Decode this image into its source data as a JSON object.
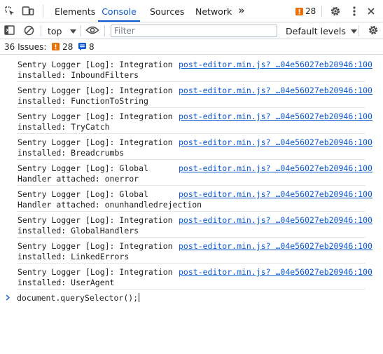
{
  "tabs": {
    "elements": "Elements",
    "console": "Console",
    "sources": "Sources",
    "network": "Network",
    "more": "»"
  },
  "header": {
    "warning_count": "28"
  },
  "toolbar": {
    "context": "top",
    "filter_placeholder": "Filter",
    "levels": "Default levels"
  },
  "issues": {
    "label": "36 Issues:",
    "warnings": "28",
    "messages": "8"
  },
  "messages": [
    {
      "line1": "Sentry Logger [Log]: Integration",
      "line2": "installed: InboundFilters",
      "source": "post-editor.min.js? …04e56027eb20946:100"
    },
    {
      "line1": "Sentry Logger [Log]: Integration",
      "line2": "installed: FunctionToString",
      "source": "post-editor.min.js? …04e56027eb20946:100"
    },
    {
      "line1": "Sentry Logger [Log]: Integration",
      "line2": "installed: TryCatch",
      "source": "post-editor.min.js? …04e56027eb20946:100"
    },
    {
      "line1": "Sentry Logger [Log]: Integration",
      "line2": "installed: Breadcrumbs",
      "source": "post-editor.min.js? …04e56027eb20946:100"
    },
    {
      "line1": "Sentry Logger [Log]: Global",
      "line2": "Handler attached: onerror",
      "source": "post-editor.min.js? …04e56027eb20946:100"
    },
    {
      "line1": "Sentry Logger [Log]: Global",
      "line2": "Handler attached: onunhandledrejection",
      "source": "post-editor.min.js? …04e56027eb20946:100"
    },
    {
      "line1": "Sentry Logger [Log]: Integration",
      "line2": "installed: GlobalHandlers",
      "source": "post-editor.min.js? …04e56027eb20946:100"
    },
    {
      "line1": "Sentry Logger [Log]: Integration",
      "line2": "installed: LinkedErrors",
      "source": "post-editor.min.js? …04e56027eb20946:100"
    },
    {
      "line1": "Sentry Logger [Log]: Integration",
      "line2": "installed: UserAgent",
      "source": "post-editor.min.js? …04e56027eb20946:100"
    }
  ],
  "prompt": {
    "input": "document.querySelector();"
  },
  "colors": {
    "accent": "#0b57d0",
    "warning": "#e8710a"
  }
}
